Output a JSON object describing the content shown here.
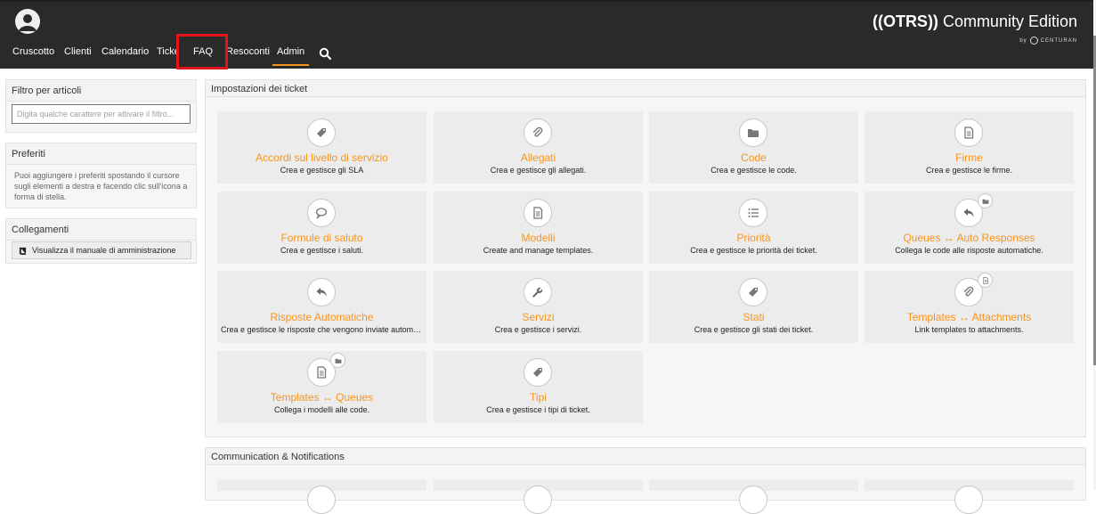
{
  "header": {
    "nav": [
      {
        "label": "Cruscotto",
        "name": "nav-cruscotto"
      },
      {
        "label": "Clienti",
        "name": "nav-clienti"
      },
      {
        "label": "Calendario",
        "name": "nav-calendario"
      },
      {
        "label": "Ticke",
        "name": "nav-ticket"
      },
      {
        "label": "FAQ",
        "name": "nav-faq"
      },
      {
        "label": "Resoconti",
        "name": "nav-resoconti"
      },
      {
        "label": "Admin",
        "name": "nav-admin"
      }
    ],
    "brand_title_bold": "((OTRS))",
    "brand_title_rest": " Community Edition",
    "brand_by": "by",
    "brand_partner": "CENTURAN",
    "accent": "#f7941d",
    "highlight_color": "#e3151a"
  },
  "sidebar": {
    "filter": {
      "title": "Filtro per articoli",
      "placeholder": "Digita qualche carattere per attivare il filtro..."
    },
    "favorites": {
      "title": "Preferiti",
      "text": "Puoi aggiungere i preferiti spostando il cursore sugli elementi a destra e facendo clic sull'icona a forma di stella."
    },
    "links": {
      "title": "Collegamenti",
      "manual_label": "Visualizza il manuale di amministrazione"
    }
  },
  "main": {
    "section1_title": "Impostazioni dei ticket",
    "section2_title": "Communication & Notifications",
    "tiles": [
      {
        "title": "Accordi sul livello di servizio",
        "desc": "Crea e gestisce gli SLA",
        "icon": "tag-icon",
        "badge": ""
      },
      {
        "title": "Allegati",
        "desc": "Crea e gestisce gli allegati.",
        "icon": "paperclip-icon",
        "badge": ""
      },
      {
        "title": "Code",
        "desc": "Crea e gestisce le code.",
        "icon": "folder-icon",
        "badge": ""
      },
      {
        "title": "Firme",
        "desc": "Crea e gestisce le firme.",
        "icon": "document-icon",
        "badge": ""
      },
      {
        "title": "Formule di saluto",
        "desc": "Crea e gestisce i saluti.",
        "icon": "speech-bubble-icon",
        "badge": ""
      },
      {
        "title": "Modelli",
        "desc": "Create and manage templates.",
        "icon": "document-icon",
        "badge": ""
      },
      {
        "title": "Priorità",
        "desc": "Crea e gestisce le priorità dei ticket.",
        "icon": "list-icon",
        "badge": ""
      },
      {
        "title": "Queues ↔ Auto Responses",
        "desc": "Collega le code alle risposte automatiche.",
        "icon": "reply-icon",
        "badge": "folder-icon"
      },
      {
        "title": "Risposte Automatiche",
        "desc": "Crea e gestisce le risposte che vengono inviate automaticamente.",
        "icon": "reply-icon",
        "badge": ""
      },
      {
        "title": "Servizi",
        "desc": "Crea e gestisce i servizi.",
        "icon": "wrench-icon",
        "badge": ""
      },
      {
        "title": "Stati",
        "desc": "Crea e gestisce gli stati dei ticket.",
        "icon": "tag-icon",
        "badge": ""
      },
      {
        "title": "Templates ↔ Attachments",
        "desc": "Link templates to attachments.",
        "icon": "paperclip-icon",
        "badge": "document-icon"
      },
      {
        "title": "Templates ↔ Queues",
        "desc": "Collega i modelli alle code.",
        "icon": "document-icon",
        "badge": "folder-icon"
      },
      {
        "title": "Tipi",
        "desc": "Crea e gestisce i tipi di ticket.",
        "icon": "tag-icon",
        "badge": ""
      }
    ]
  }
}
